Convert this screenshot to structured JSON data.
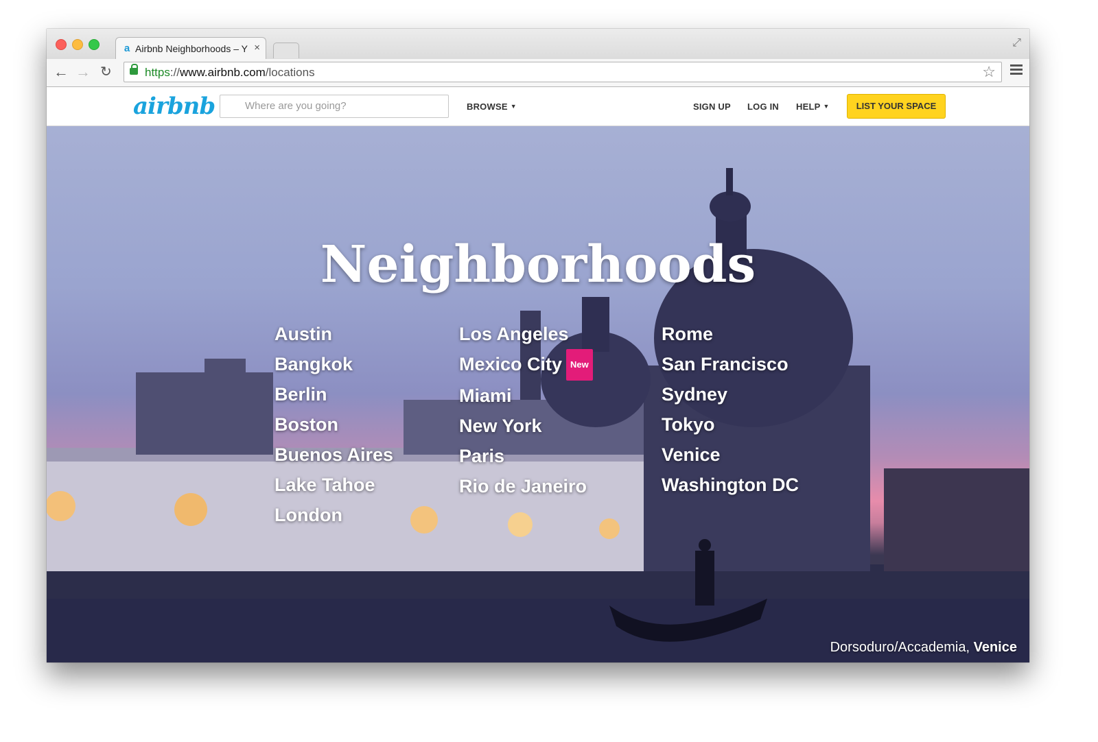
{
  "browser": {
    "tab_title": "Airbnb Neighborhoods – Y",
    "tab_favicon": "airbnb-favicon",
    "url_scheme": "https",
    "url_sep": "://",
    "url_host": "www.airbnb.com",
    "url_path": "/locations"
  },
  "site": {
    "logo": "airbnb",
    "search_placeholder": "Where are you going?",
    "nav": {
      "browse": "BROWSE",
      "sign_up": "SIGN UP",
      "log_in": "LOG IN",
      "help": "HELP",
      "list_space": "LIST YOUR SPACE"
    }
  },
  "hero": {
    "title": "Neighborhoods",
    "columns": [
      [
        "Austin",
        "Bangkok",
        "Berlin",
        "Boston",
        "Buenos Aires",
        "Lake Tahoe",
        "London"
      ],
      [
        "Los Angeles",
        "Mexico City",
        "Miami",
        "New York",
        "Paris",
        "Rio de Janeiro"
      ],
      [
        "Rome",
        "San Francisco",
        "Sydney",
        "Tokyo",
        "Venice",
        "Washington DC"
      ]
    ],
    "new_badge": "New",
    "caption_neighborhood": "Dorsoduro/Accademia,",
    "caption_city": "Venice"
  },
  "colors": {
    "accent_logo": "#1aa3dd",
    "list_space_button": "#ffd31f",
    "new_badge": "#e31c79"
  }
}
